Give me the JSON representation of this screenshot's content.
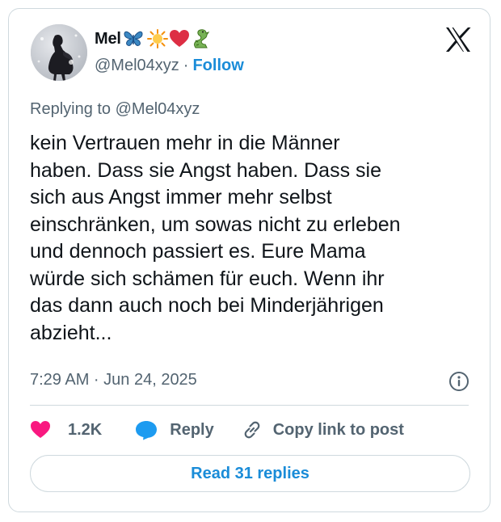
{
  "author": {
    "display_name": "Mel",
    "emojis": [
      "butterfly-icon",
      "sun-icon",
      "heart-icon",
      "dragon-icon"
    ],
    "handle": "@Mel04xyz",
    "separator": "·",
    "follow_label": "Follow"
  },
  "tweet": {
    "reply_context": "Replying to @Mel04xyz",
    "text": "kein Vertrauen mehr in die Männer\nhaben. Dass sie Angst haben. Dass sie\nsich aus Angst immer mehr selbst\neinschränken, um sowas nicht zu erleben\nund dennoch passiert es. Eure Mama\nwürde sich schämen für euch. Wenn ihr\ndas dann auch noch bei Minderjährigen\nabzieht...",
    "timestamp": "7:29 AM · Jun 24, 2025"
  },
  "actions": {
    "like_count": "1.2K",
    "reply_label": "Reply",
    "copy_label": "Copy link to post"
  },
  "footer": {
    "read_replies_label": "Read 31 replies"
  },
  "colors": {
    "accent": "#1a8cd8",
    "like": "#f91880",
    "muted": "#536471",
    "border": "#cfd9de"
  }
}
